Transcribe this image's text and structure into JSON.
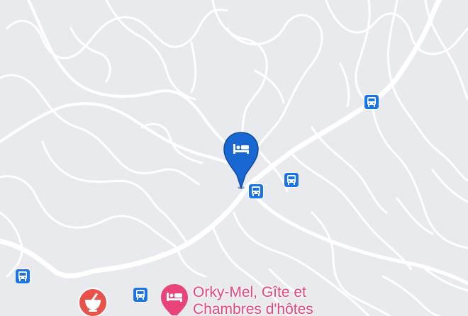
{
  "map": {
    "colors": {
      "land": "#e8eaed",
      "road": "#ffffff",
      "hotel_pin": "#1967d2",
      "bus_stop": "#1a73e8",
      "poi_lodging": "#e8447a",
      "poi_pharmacy": "#e8524a"
    },
    "markers": {
      "selected": {
        "icon": "bed-icon"
      },
      "bus_stop_icon": "bus-icon",
      "pharmacy_icon": "mortar-pestle-icon",
      "lodging_icon": "bed-icon"
    },
    "poi": {
      "label_line1": "Orky-Mel, Gîte et",
      "label_line2": "Chambres d'hôtes"
    }
  }
}
